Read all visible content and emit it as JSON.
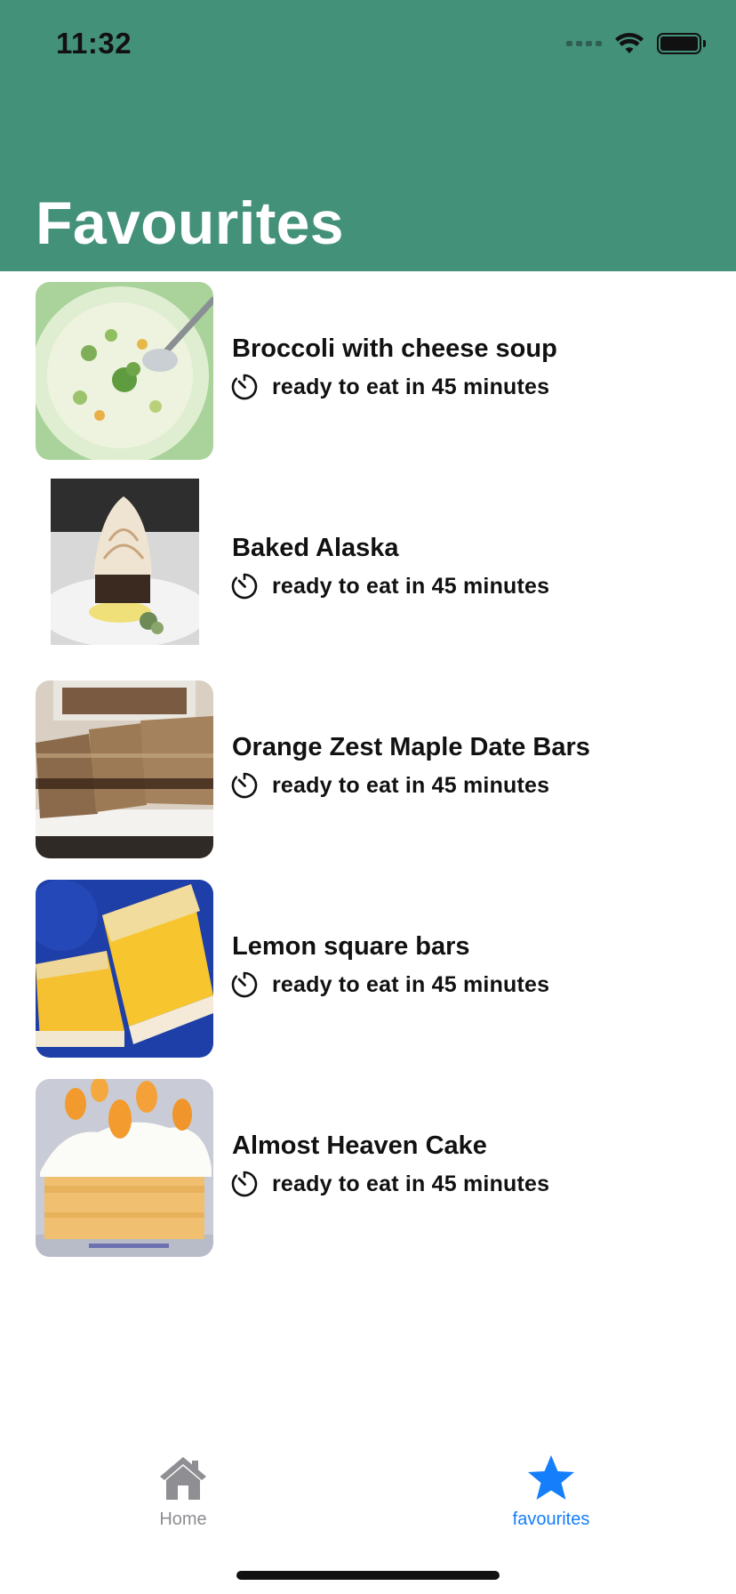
{
  "status_bar": {
    "time": "11:32"
  },
  "header": {
    "title": "Favourites",
    "background_color": "#44917A"
  },
  "recipes": [
    {
      "title": "Broccoli with cheese soup",
      "meta": "ready to eat in 45 minutes",
      "image_icon": "broccoli-soup-photo"
    },
    {
      "title": "Baked Alaska",
      "meta": "ready to eat in 45 minutes",
      "image_icon": "baked-alaska-photo"
    },
    {
      "title": "Orange Zest Maple Date Bars",
      "meta": "ready to eat in 45 minutes",
      "image_icon": "date-bars-photo"
    },
    {
      "title": "Lemon square bars",
      "meta": "ready to eat in 45 minutes",
      "image_icon": "lemon-bars-photo"
    },
    {
      "title": "Almost Heaven Cake",
      "meta": "ready to eat in 45 minutes",
      "image_icon": "heaven-cake-photo"
    }
  ],
  "tab_bar": {
    "tabs": [
      {
        "label": "Home",
        "icon": "house-icon",
        "selected": false
      },
      {
        "label": "favourites",
        "icon": "star-icon",
        "selected": true
      }
    ],
    "active_color": "#157EFB",
    "inactive_color": "#8E8E93"
  }
}
